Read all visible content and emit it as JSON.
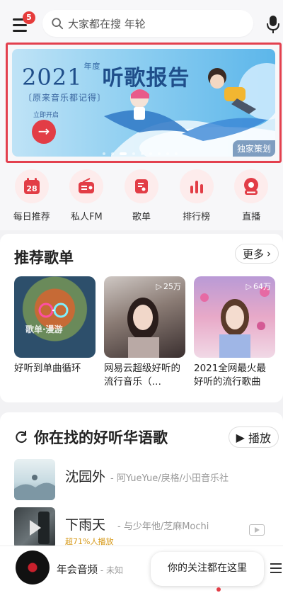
{
  "header": {
    "menu_badge": "5",
    "search_placeholder": "大家都在搜 年轮"
  },
  "banner": {
    "year": "2021",
    "year_suffix": "年度",
    "title": "听歌报告",
    "subtitle": "〔原来音乐都记得〕",
    "small_text": "立即开启",
    "tag": "独家策划"
  },
  "quick_entries": [
    {
      "label": "每日推荐",
      "icon": "calendar-icon",
      "day": "28"
    },
    {
      "label": "私人FM",
      "icon": "radio-icon"
    },
    {
      "label": "歌单",
      "icon": "playlist-icon"
    },
    {
      "label": "排行榜",
      "icon": "chart-bars-icon"
    },
    {
      "label": "直播",
      "icon": "live-icon"
    }
  ],
  "recommend": {
    "title": "推荐歌单",
    "more": "更多",
    "cards": [
      {
        "name": "好听到单曲循环",
        "count": "",
        "cover_text": "歌单·漫游"
      },
      {
        "name": "网易云超级好听的流行音乐（…",
        "count": "25万"
      },
      {
        "name": "2021全网最火最好听的流行歌曲",
        "count": "64万"
      }
    ]
  },
  "discover": {
    "title": "你在找的好听华语歌",
    "play": "播放",
    "songs": [
      {
        "title": "沈园外",
        "artist": "- 阿YueYue/戾格/小田音乐社",
        "hot": ""
      },
      {
        "title": "下雨天",
        "artist": "- 与少年他/芝麻Mochi",
        "hot": "超71%人播放"
      }
    ]
  },
  "mini_player": {
    "title": "年会音频",
    "subtitle": " - 未知",
    "tooltip": "你的关注都在这里"
  },
  "colors": {
    "accent": "#e23d46",
    "banner_border": "#e3404e"
  }
}
